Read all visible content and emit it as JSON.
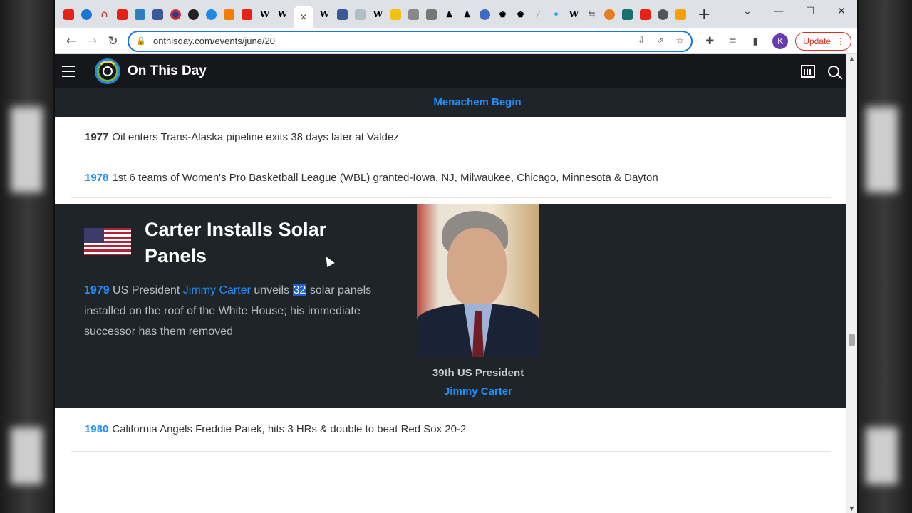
{
  "browser": {
    "tabs": [
      "youtube",
      "edge",
      "headset",
      "youtube",
      "book",
      "app",
      "target",
      "github",
      "globe",
      "blogger",
      "youtube",
      "W",
      "W",
      "W",
      "app",
      "sbs",
      "W",
      "W",
      "app",
      "app",
      "app",
      "chess",
      "chess",
      "globe",
      "app",
      "app",
      "feather",
      "twitter",
      "W",
      "app",
      "app",
      "app",
      "youtube",
      "globe",
      "SM"
    ],
    "active_tab_close": "×",
    "new_tab": "+",
    "url": "onthisday.com/events/june/20",
    "profile_initial": "K",
    "update_label": "Update"
  },
  "site": {
    "title": "On This Day",
    "strip_link": "Menachem Begin"
  },
  "events_top": [
    {
      "year": "1977",
      "text": "Oil enters Trans-Alaska pipeline exits 38 days later at Valdez"
    },
    {
      "year": "1978",
      "text": "1st 6 teams of Women's Pro Basketball League (WBL) granted-Iowa, NJ, Milwaukee, Chicago, Minnesota & Dayton"
    }
  ],
  "feature": {
    "title": "Carter Installs Solar Panels",
    "year": "1979",
    "text_before": "US President",
    "person_link": "Jimmy Carter",
    "text_mid": "unveils",
    "highlight": "32",
    "text_after": "solar panels installed on the roof of the White House; his immediate successor has them removed",
    "caption_role": "39th US President",
    "caption_name": "Jimmy Carter"
  },
  "events_bottom": [
    {
      "year": "1980",
      "text": "California Angels Freddie Patek, hits 3 HRs & double to beat Red Sox 20-2"
    }
  ]
}
